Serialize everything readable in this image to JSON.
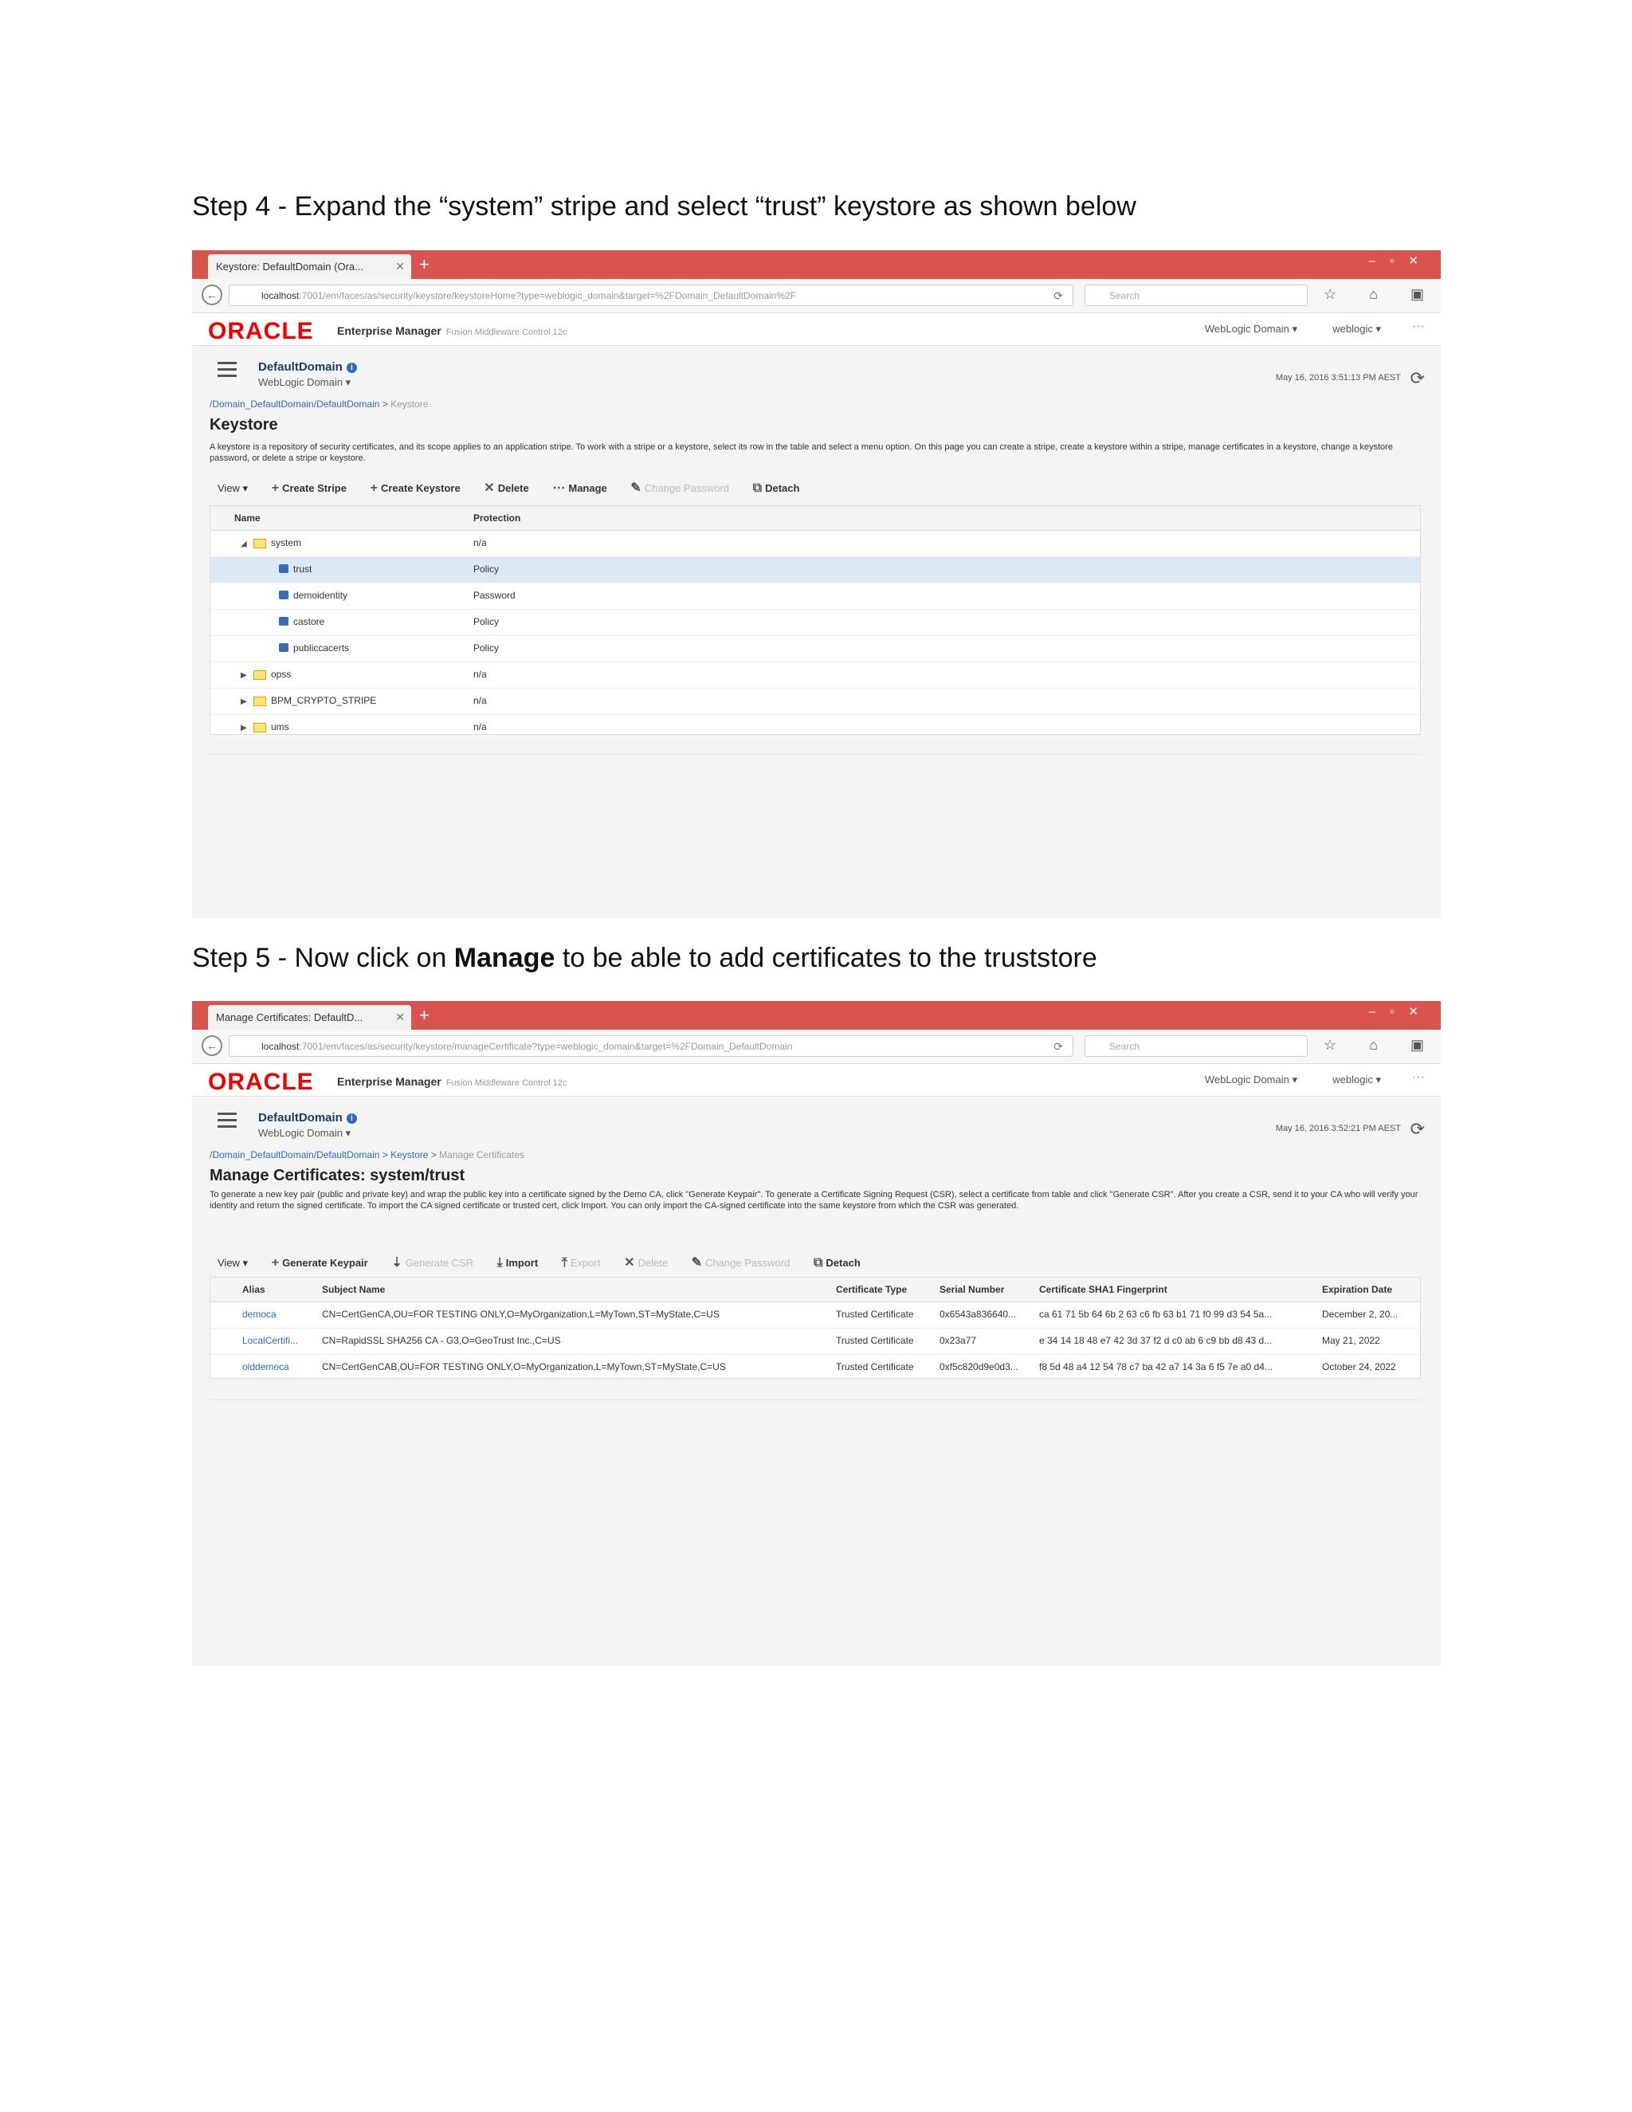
{
  "step4": {
    "heading": "Step 4 - Expand the “system” stripe and select “trust” keystore as shown below",
    "browser": {
      "tab_title": "Keystore: DefaultDomain (Ora...",
      "url_host": "localhost",
      "url_path": ":7001/em/faces/as/security/keystore/keystoreHome?type=weblogic_domain&target=%2FDomain_DefaultDomain%2F",
      "search_placeholder": "Search"
    },
    "em": {
      "logo": "ORACLE",
      "title": "Enterprise Manager",
      "subtitle": "Fusion Middleware Control 12c",
      "domain_menu": "WebLogic Domain ▾",
      "user_menu": "weblogic ▾",
      "domain_name": "DefaultDomain",
      "domain_sub": "WebLogic Domain ▾",
      "timestamp": "May 16, 2016 3:51:13 PM AEST",
      "breadcrumb_link": "/Domain_DefaultDomain/DefaultDomain",
      "breadcrumb_current": "Keystore",
      "page_title": "Keystore",
      "description": "A keystore is a repository of security certificates, and its scope applies to an application stripe. To work with a stripe or a keystore, select its row in the table and select a menu option. On this page you can create a stripe, create a keystore within a stripe, manage certificates in a keystore, change a keystore password, or delete a stripe or keystore."
    },
    "toolbar": {
      "view": "View ▾",
      "create_stripe": "Create Stripe",
      "create_keystore": "Create Keystore",
      "delete": "Delete",
      "manage": "Manage",
      "change_password": "Change Password",
      "detach": "Detach"
    },
    "table": {
      "col_name": "Name",
      "col_protection": "Protection",
      "rows": [
        {
          "name": "system",
          "protection": "n/a"
        },
        {
          "name": "trust",
          "protection": "Policy"
        },
        {
          "name": "demoidentity",
          "protection": "Password"
        },
        {
          "name": "castore",
          "protection": "Policy"
        },
        {
          "name": "publiccacerts",
          "protection": "Policy"
        },
        {
          "name": "opss",
          "protection": "n/a"
        },
        {
          "name": "BPM_CRYPTO_STRIPE",
          "protection": "n/a"
        },
        {
          "name": "ums",
          "protection": "n/a"
        }
      ]
    }
  },
  "step5": {
    "heading_prefix": "Step 5 - Now click on ",
    "heading_bold": "Manage",
    "heading_suffix": " to be able to add certificates to the truststore",
    "browser": {
      "tab_title": "Manage Certificates: DefaultD...",
      "url_host": "localhost",
      "url_path": ":7001/em/faces/as/security/keystore/manageCertificate?type=weblogic_domain&target=%2FDomain_DefaultDomain",
      "search_placeholder": "Search"
    },
    "em": {
      "logo": "ORACLE",
      "title": "Enterprise Manager",
      "subtitle": "Fusion Middleware Control 12c",
      "domain_menu": "WebLogic Domain ▾",
      "user_menu": "weblogic ▾",
      "domain_name": "DefaultDomain",
      "domain_sub": "WebLogic Domain ▾",
      "timestamp": "May 16, 2016 3:52:21 PM AEST",
      "breadcrumb_link": "/Domain_DefaultDomain/DefaultDomain",
      "breadcrumb_mid": "Keystore",
      "breadcrumb_current": "Manage Certificates",
      "page_title": "Manage Certificates: system/trust",
      "description": "To generate a new key pair (public and private key) and wrap the public key into a certificate signed by the Demo CA, click \"Generate Keypair\". To generate a Certificate Signing Request (CSR), select a certificate from table and click \"Generate CSR\". After you create a CSR, send it to your CA who will verify your identity and return the signed certificate. To import the CA signed certificate or trusted cert, click Import. You can only import the CA-signed certificate into the same keystore from which the CSR was generated."
    },
    "toolbar": {
      "view": "View ▾",
      "generate_keypair": "Generate Keypair",
      "generate_csr": "Generate CSR",
      "import": "Import",
      "export": "Export",
      "delete": "Delete",
      "change_password": "Change Password",
      "detach": "Detach"
    },
    "table": {
      "col_alias": "Alias",
      "col_subject": "Subject Name",
      "col_type": "Certificate Type",
      "col_serial": "Serial Number",
      "col_fingerprint": "Certificate SHA1 Fingerprint",
      "col_expiration": "Expiration Date",
      "rows": [
        {
          "alias": "democa",
          "subject": "CN=CertGenCA,OU=FOR TESTING ONLY,O=MyOrganization,L=MyTown,ST=MyState,C=US",
          "type": "Trusted Certificate",
          "serial": "0x6543a836640...",
          "fingerprint": "ca 61 71 5b 64 6b 2 63 c6 fb 63 b1 71 f0 99 d3 54 5a...",
          "expiration": "December 2, 20..."
        },
        {
          "alias": "LocalCertifi...",
          "subject": "CN=RapidSSL SHA256 CA - G3,O=GeoTrust Inc.,C=US",
          "type": "Trusted Certificate",
          "serial": "0x23a77",
          "fingerprint": "e 34 14 18 48 e7 42 3d 37 f2 d c0 ab 6 c9 bb d8 43 d...",
          "expiration": "May 21, 2022"
        },
        {
          "alias": "olddemoca",
          "subject": "CN=CertGenCAB,OU=FOR TESTING ONLY,O=MyOrganization,L=MyTown,ST=MyState,C=US",
          "type": "Trusted Certificate",
          "serial": "0xf5c820d9e0d3...",
          "fingerprint": "f8 5d 48 a4 12 54 78 c7 ba 42 a7 14 3a 6 f5 7e a0 d4...",
          "expiration": "October 24, 2022"
        }
      ]
    }
  }
}
